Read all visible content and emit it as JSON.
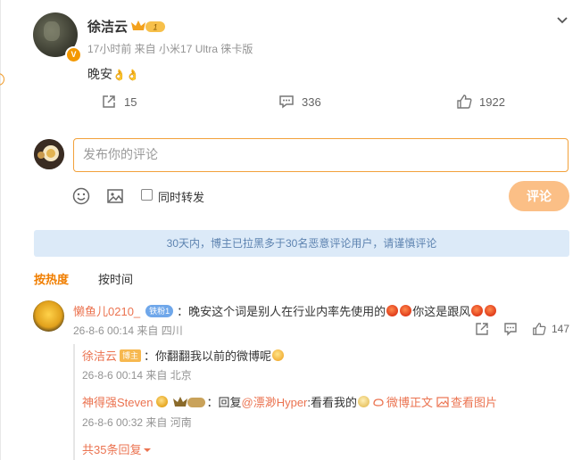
{
  "post": {
    "author": "徐洁云",
    "meta": "17小时前  来自 小米17 Ultra 徕卡版",
    "text": "晚安",
    "text_emoji": "👌👌",
    "shares": "15",
    "comments": "336",
    "likes": "1922",
    "crown_level": "1"
  },
  "composer": {
    "placeholder": "发布你的评论",
    "repost_label": "同时转发",
    "submit_label": "评论"
  },
  "notice": "30天内，博主已拉黑多于30名恶意评论用户，请谨慎评论",
  "sort_tabs": [
    {
      "label": "按热度",
      "active": true
    },
    {
      "label": "按时间",
      "active": false
    }
  ],
  "comment": {
    "user": "懒鱼儿0210_",
    "fan_badge": "铁粉1",
    "text_a": "：晚安这个词是别人在行业内率先使用的",
    "text_b": "你这是跟风",
    "meta": "26-8-6 00:14 来自 四川",
    "likes": "147"
  },
  "replies": [
    {
      "user": "徐洁云",
      "badge": "博主",
      "text": "：你翻翻我以前的微博呢",
      "meta": "26-8-6 00:14 来自 北京"
    },
    {
      "user": "神得强Steven",
      "prefix": "：回复 ",
      "mention": "@漂渺Hyper",
      "text": ":看看我的",
      "link1": "微博正文",
      "link2": "查看图片",
      "meta": "26-8-6 00:32 来自 河南"
    }
  ],
  "more_replies": "共35条回复",
  "colors": {
    "accent": "#f07e00",
    "link": "#eb7350",
    "notice_bg": "#dceaf8",
    "submit_bg": "#fbbf86"
  }
}
